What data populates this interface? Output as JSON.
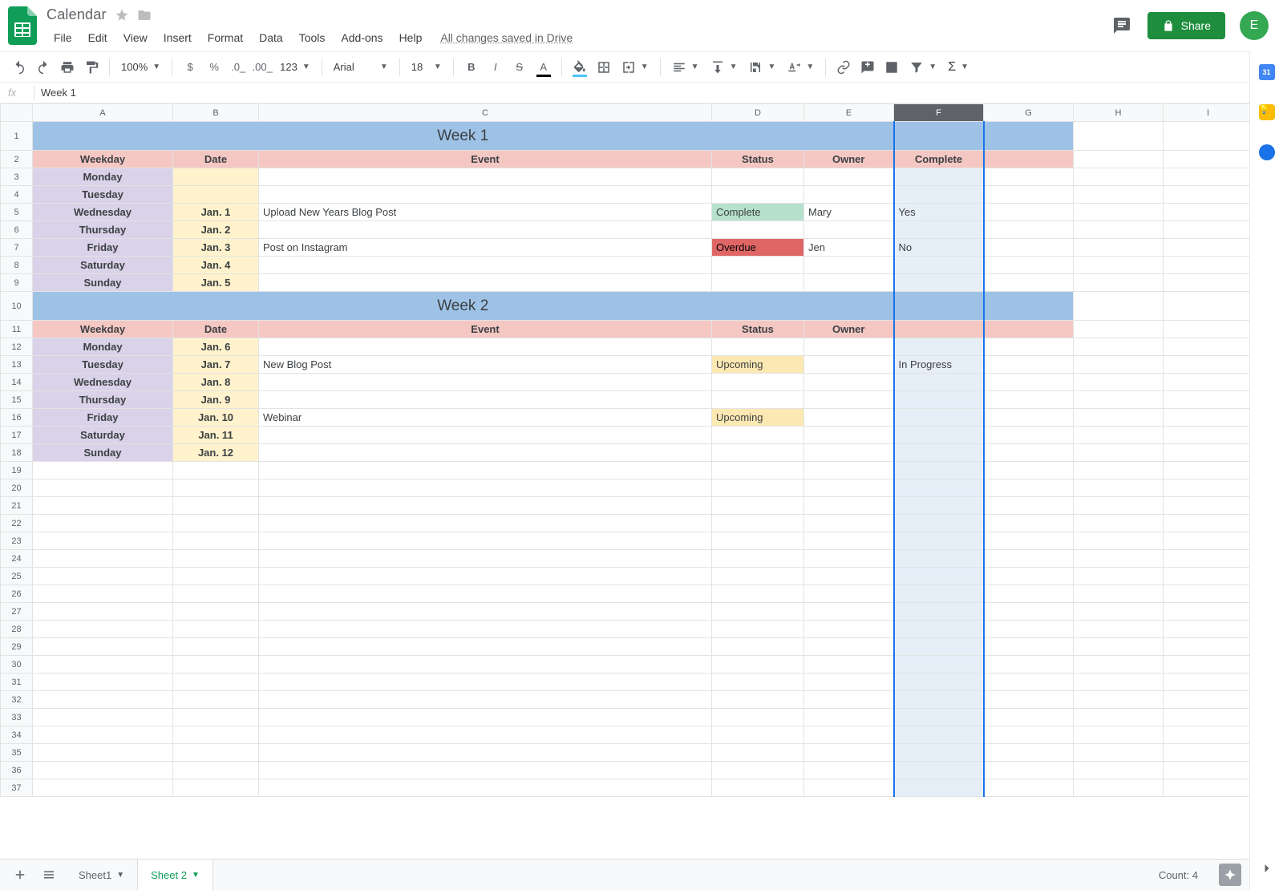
{
  "doc": {
    "title": "Calendar",
    "save_status": "All changes saved in Drive"
  },
  "menus": {
    "file": "File",
    "edit": "Edit",
    "view": "View",
    "insert": "Insert",
    "format": "Format",
    "data": "Data",
    "tools": "Tools",
    "addons": "Add-ons",
    "help": "Help"
  },
  "share": {
    "label": "Share"
  },
  "avatar": {
    "initial": "E"
  },
  "toolbar": {
    "zoom": "100%",
    "font": "Arial",
    "fontsize": "18",
    "numfmt": "123"
  },
  "formula_bar": {
    "value": "Week 1"
  },
  "columns": [
    "A",
    "B",
    "C",
    "D",
    "E",
    "F",
    "G",
    "H",
    "I"
  ],
  "selected_column_index": 5,
  "selected_column_letter": "F",
  "total_rows": 37,
  "colors": {
    "week_header": "#9ec2e6",
    "header_row": "#f4c7c3",
    "weekday": "#d9d2e9",
    "date": "#fff2cc",
    "status_complete": "#b7e1cd",
    "status_overdue": "#e06666",
    "status_upcoming": "#fce8b2",
    "selection": "#e6eef8"
  },
  "spreadsheet": {
    "weeks": [
      {
        "title": "Week 1",
        "header_row": 1,
        "columns_header_row": 2,
        "columns": {
          "a": "Weekday",
          "b": "Date",
          "c": "Event",
          "d": "Status",
          "e": "Owner",
          "f": "Complete",
          "g": ""
        },
        "rows": [
          {
            "n": 3,
            "weekday": "Monday",
            "date": "",
            "event": "",
            "status": "",
            "status_style": "",
            "owner": "",
            "complete": ""
          },
          {
            "n": 4,
            "weekday": "Tuesday",
            "date": "",
            "event": "",
            "status": "",
            "status_style": "",
            "owner": "",
            "complete": ""
          },
          {
            "n": 5,
            "weekday": "Wednesday",
            "date": "Jan. 1",
            "event": "Upload New Years Blog Post",
            "status": "Complete",
            "status_style": "complete",
            "owner": "Mary",
            "complete": "Yes"
          },
          {
            "n": 6,
            "weekday": "Thursday",
            "date": "Jan. 2",
            "event": "",
            "status": "",
            "status_style": "",
            "owner": "",
            "complete": ""
          },
          {
            "n": 7,
            "weekday": "Friday",
            "date": "Jan. 3",
            "event": "Post on Instagram",
            "status": "Overdue",
            "status_style": "overdue",
            "owner": "Jen",
            "complete": "No"
          },
          {
            "n": 8,
            "weekday": "Saturday",
            "date": "Jan. 4",
            "event": "",
            "status": "",
            "status_style": "",
            "owner": "",
            "complete": ""
          },
          {
            "n": 9,
            "weekday": "Sunday",
            "date": "Jan. 5",
            "event": "",
            "status": "",
            "status_style": "",
            "owner": "",
            "complete": ""
          }
        ]
      },
      {
        "title": "Week 2",
        "header_row": 10,
        "columns_header_row": 11,
        "columns": {
          "a": "Weekday",
          "b": "Date",
          "c": "Event",
          "d": "Status",
          "e": "Owner",
          "f": "",
          "g": ""
        },
        "rows": [
          {
            "n": 12,
            "weekday": "Monday",
            "date": "Jan. 6",
            "event": "",
            "status": "",
            "status_style": "",
            "owner": "",
            "complete": ""
          },
          {
            "n": 13,
            "weekday": "Tuesday",
            "date": "Jan. 7",
            "event": "New Blog Post",
            "status": "Upcoming",
            "status_style": "upcoming",
            "owner": "",
            "complete": "In Progress"
          },
          {
            "n": 14,
            "weekday": "Wednesday",
            "date": "Jan. 8",
            "event": "",
            "status": "",
            "status_style": "",
            "owner": "",
            "complete": ""
          },
          {
            "n": 15,
            "weekday": "Thursday",
            "date": "Jan. 9",
            "event": "",
            "status": "",
            "status_style": "",
            "owner": "",
            "complete": ""
          },
          {
            "n": 16,
            "weekday": "Friday",
            "date": "Jan. 10",
            "event": "Webinar",
            "status": "Upcoming",
            "status_style": "upcoming",
            "owner": "",
            "complete": ""
          },
          {
            "n": 17,
            "weekday": "Saturday",
            "date": "Jan. 11",
            "event": "",
            "status": "",
            "status_style": "",
            "owner": "",
            "complete": ""
          },
          {
            "n": 18,
            "weekday": "Sunday",
            "date": "Jan. 12",
            "event": "",
            "status": "",
            "status_style": "",
            "owner": "",
            "complete": ""
          }
        ]
      }
    ]
  },
  "sheet_tabs": [
    {
      "name": "Sheet1",
      "active": false
    },
    {
      "name": "Sheet 2",
      "active": true
    }
  ],
  "statusbar": {
    "count_label": "Count:",
    "count_value": "4"
  }
}
